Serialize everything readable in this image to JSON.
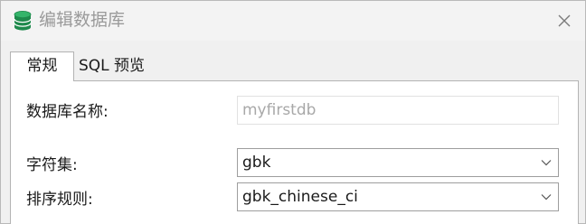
{
  "window": {
    "title": "编辑数据库",
    "icon": "database-icon",
    "close_icon": "close-icon"
  },
  "tabs": [
    {
      "label": "常规",
      "active": true
    },
    {
      "label": "SQL 预览",
      "active": false
    }
  ],
  "form": {
    "db_name": {
      "label": "数据库名称:",
      "value": "myfirstdb"
    },
    "charset": {
      "label": "字符集:",
      "value": "gbk"
    },
    "collation": {
      "label": "排序规则:",
      "value": "gbk_chinese_ci"
    }
  },
  "colors": {
    "icon_green": "#1e8a4c",
    "disabled_text": "#a8a8a8"
  }
}
